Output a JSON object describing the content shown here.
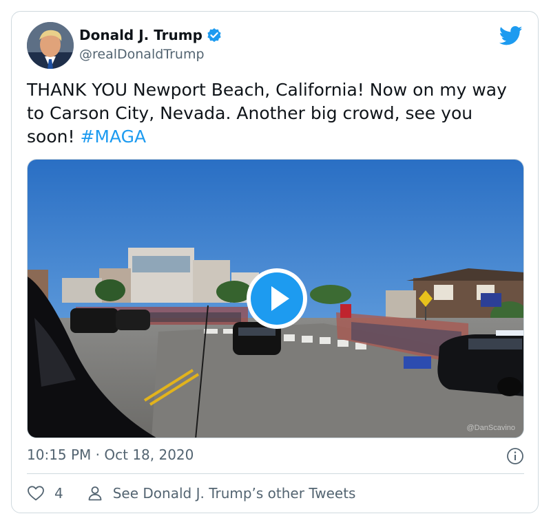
{
  "author": {
    "name": "Donald J. Trump",
    "handle": "@realDonaldTrump",
    "verified": true
  },
  "tweet": {
    "text": "THANK YOU Newport Beach, California! Now on my way to Carson City, Nevada. Another big crowd, see you soon! ",
    "hashtag": "#MAGA",
    "timestamp": "10:15 PM · Oct 18, 2020"
  },
  "media": {
    "type": "video",
    "watermark": "@DanScavino",
    "play_icon": "play-icon"
  },
  "actions": {
    "like_count": "4",
    "other_tweets_label": "See Donald J. Trump’s other Tweets"
  },
  "colors": {
    "accent": "#1d9bf0",
    "text_primary": "#0f1419",
    "text_secondary": "#536471",
    "border": "#cfd9de"
  }
}
